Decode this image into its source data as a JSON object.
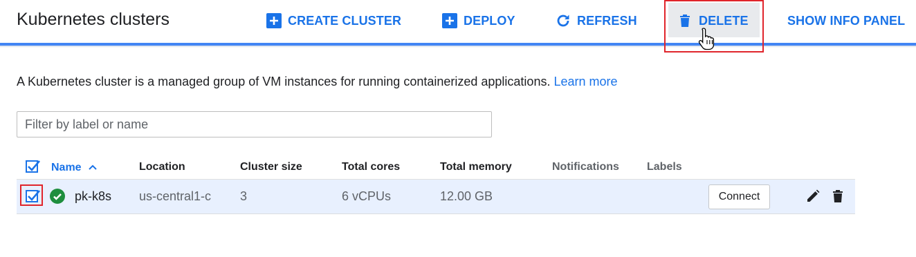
{
  "header": {
    "title": "Kubernetes clusters",
    "actions": {
      "create": "CREATE CLUSTER",
      "deploy": "DEPLOY",
      "refresh": "REFRESH",
      "delete": "DELETE",
      "info": "SHOW INFO PANEL"
    }
  },
  "description": {
    "text": "A Kubernetes cluster is a managed group of VM instances for running containerized applications.",
    "link": "Learn more"
  },
  "filter": {
    "placeholder": "Filter by label or name",
    "value": ""
  },
  "table": {
    "columns": {
      "name": "Name",
      "location": "Location",
      "size": "Cluster size",
      "cores": "Total cores",
      "memory": "Total memory",
      "notifications": "Notifications",
      "labels": "Labels"
    },
    "rows": [
      {
        "name": "pk-k8s",
        "location": "us-central1-c",
        "size": "3",
        "cores": "6 vCPUs",
        "memory": "12.00 GB",
        "connect": "Connect",
        "checked": true,
        "status": "check-circle-icon"
      }
    ]
  },
  "colors": {
    "accent": "#1a73e8",
    "status_ok": "#1e8e3e",
    "highlight": "#e0242b",
    "selected_row": "#e8f0fe"
  }
}
